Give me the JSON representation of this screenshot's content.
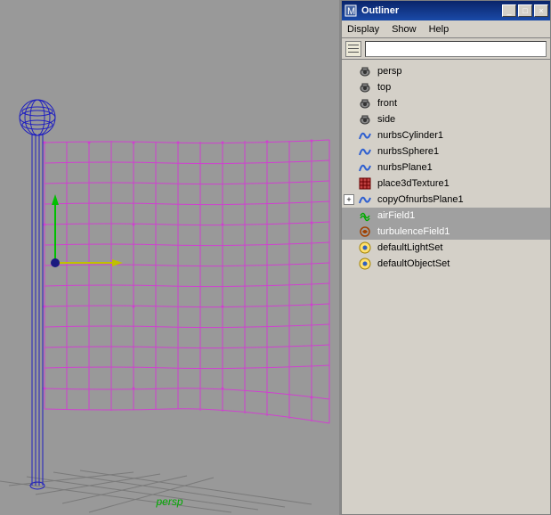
{
  "viewport": {
    "label": "persp"
  },
  "outliner": {
    "title": "Outliner",
    "menu": {
      "display": "Display",
      "show": "Show",
      "help": "Help"
    },
    "search_placeholder": "",
    "items": [
      {
        "label": "persp",
        "icon": "camera",
        "expand": "none",
        "sel": false
      },
      {
        "label": "top",
        "icon": "camera",
        "expand": "none",
        "sel": false
      },
      {
        "label": "front",
        "icon": "camera",
        "expand": "none",
        "sel": false
      },
      {
        "label": "side",
        "icon": "camera",
        "expand": "none",
        "sel": false
      },
      {
        "label": "nurbsCylinder1",
        "icon": "nurbs",
        "expand": "none",
        "sel": false
      },
      {
        "label": "nurbsSphere1",
        "icon": "nurbs",
        "expand": "none",
        "sel": false
      },
      {
        "label": "nurbsPlane1",
        "icon": "nurbs",
        "expand": "none",
        "sel": false
      },
      {
        "label": "place3dTexture1",
        "icon": "tex",
        "expand": "none",
        "sel": false
      },
      {
        "label": "copyOfnurbsPlane1",
        "icon": "nurbs",
        "expand": "plus",
        "sel": false
      },
      {
        "label": "airField1",
        "icon": "field-air",
        "expand": "none",
        "sel": true
      },
      {
        "label": "turbulenceField1",
        "icon": "field-turb",
        "expand": "none",
        "sel": true
      },
      {
        "label": "defaultLightSet",
        "icon": "set",
        "expand": "none",
        "sel": false
      },
      {
        "label": "defaultObjectSet",
        "icon": "set",
        "expand": "none",
        "sel": false
      }
    ]
  },
  "winbtns": {
    "min": "_",
    "max": "□",
    "close": "×"
  }
}
